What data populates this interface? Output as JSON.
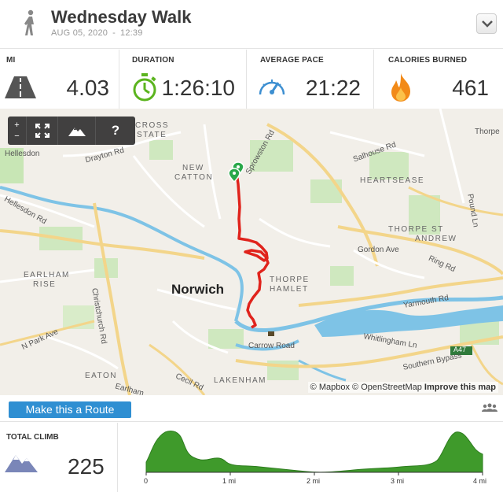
{
  "header": {
    "title": "Wednesday Walk",
    "date": "AUG 05, 2020",
    "time": "12:39"
  },
  "stats": [
    {
      "label": "MI",
      "value": "4.03",
      "icon": "road-icon"
    },
    {
      "label": "DURATION",
      "value": "1:26:10",
      "icon": "stopwatch-icon"
    },
    {
      "label": "AVERAGE PACE",
      "value": "21:22",
      "icon": "speedometer-icon"
    },
    {
      "label": "CALORIES BURNED",
      "value": "461",
      "icon": "flame-icon"
    }
  ],
  "map": {
    "toolbar": {
      "zoom_in": "+",
      "zoom_out": "−",
      "help": "?"
    },
    "city": "Norwich",
    "areas": [
      "CROSS",
      "STATE",
      "NEW",
      "CATTON",
      "HEARTSEASE",
      "THORPE ST",
      "ANDREW",
      "EARLHAM",
      "RISE",
      "THORPE",
      "HAMLET",
      "EATON",
      "LAKENHAM"
    ],
    "roads": [
      "Hellesdon",
      "Drayton Rd",
      "Hellesdon Rd",
      "Sprowston Rd",
      "Salhouse Rd",
      "Thorpe",
      "Pound Ln",
      "Gordon Ave",
      "Ring Rd",
      "Yarmouth Rd",
      "Whitlingham Ln",
      "A47",
      "Southern Bypass",
      "Carrow Road",
      "Christchurch Rd",
      "N Park Ave",
      "Cecil Rd",
      "Earlham"
    ],
    "attribution": {
      "mapbox": "© Mapbox",
      "osm": "© OpenStreetMap",
      "improve": "Improve this map"
    }
  },
  "route_button": "Make this a Route",
  "climb": {
    "label": "TOTAL CLIMB",
    "value": "225",
    "axis": [
      "0",
      "1 mi",
      "2 mi",
      "3 mi",
      "4 mi"
    ]
  },
  "colors": {
    "accent": "#2f8fd2",
    "route": "#e0231c",
    "profile": "#3f9a2b",
    "icon_green": "#5bb41e",
    "icon_blue": "#3d8fd1",
    "icon_orange": "#f28a18"
  }
}
